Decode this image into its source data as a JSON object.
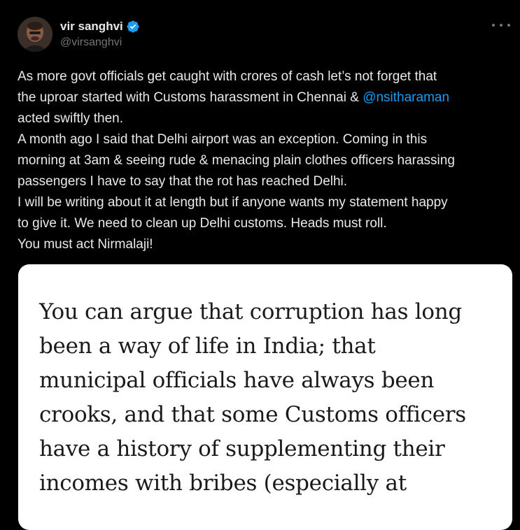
{
  "author": {
    "display_name": "vir sanghvi",
    "handle": "@virsanghvi",
    "verified": true
  },
  "icons": {
    "verified": "verified-badge-icon",
    "more": "more-options-icon"
  },
  "colors": {
    "background": "#000000",
    "text": "#e7e9ea",
    "muted": "#71767b",
    "link": "#1d9bf0"
  },
  "tweet": {
    "line1": "As more govt officials get caught with crores of cash let’s not forget that",
    "line2_text": "the uproar started with Customs harassment in Chennai & ",
    "line2_mention": "@nsitharaman",
    "line3": "acted swiftly then.",
    "line4": "A month ago I said that Delhi airport was an exception. Coming in this",
    "line5": "morning at 3am & seeing rude & menacing plain clothes officers harassing",
    "line6": "passengers I have to say that the rot has reached Delhi.",
    "line7": "I will be writing about it at length but if anyone wants my statement happy",
    "line8": "to give it. We need to clean up Delhi customs. Heads must roll.",
    "line9": "You must act Nirmalaji!"
  },
  "media": {
    "lines": [
      "You can argue that corruption has long",
      "been a way of life in India; that",
      "municipal officials have always been",
      "crooks, and that some Customs officers",
      "have a history of supplementing their",
      "incomes with bribes (especially at"
    ]
  }
}
